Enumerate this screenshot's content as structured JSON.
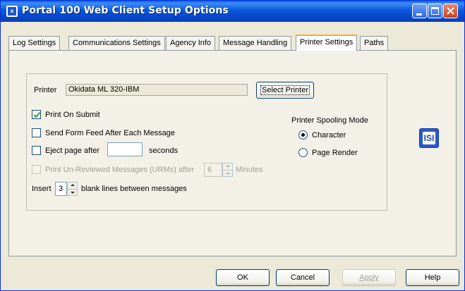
{
  "window": {
    "title": "Portal 100 Web Client Setup Options",
    "icon": "isi-logo-icon"
  },
  "tabs": [
    {
      "label": "Log Settings",
      "active": false
    },
    {
      "label": "Communications Settings",
      "active": false
    },
    {
      "label": "Agency Info",
      "active": false
    },
    {
      "label": "Message Handling",
      "active": false
    },
    {
      "label": "Printer Settings",
      "active": true
    },
    {
      "label": "Paths",
      "active": false
    }
  ],
  "printer": {
    "label": "Printer",
    "value": "Okidata ML 320-IBM",
    "select_button": "Select Printer"
  },
  "options": {
    "print_on_submit": {
      "label": "Print On Submit",
      "checked": true
    },
    "form_feed": {
      "label": "Send Form Feed After Each Message",
      "checked": false
    },
    "eject_page": {
      "label": "Eject page after",
      "checked": false,
      "value": "",
      "suffix": "seconds"
    },
    "print_unreviewed": {
      "label": "Print Un-Reviewed Messages (URMs) after",
      "checked": false,
      "disabled": true,
      "value": "6",
      "suffix": "Minutes"
    },
    "insert_blank": {
      "prefix": "Insert",
      "value": "3",
      "suffix": "blank lines between messages"
    }
  },
  "spooling": {
    "title": "Printer Spooling Mode",
    "options": [
      {
        "label": "Character",
        "selected": true
      },
      {
        "label": "Page Render",
        "selected": false
      }
    ]
  },
  "buttons": {
    "ok": "OK",
    "cancel": "Cancel",
    "apply": "Apply",
    "help": "Help"
  },
  "logo_text": "ISI",
  "colors": {
    "titlebar": "#0B58DB",
    "active_tab_accent": "#F5B032",
    "window_bg": "#ECE9D8"
  }
}
